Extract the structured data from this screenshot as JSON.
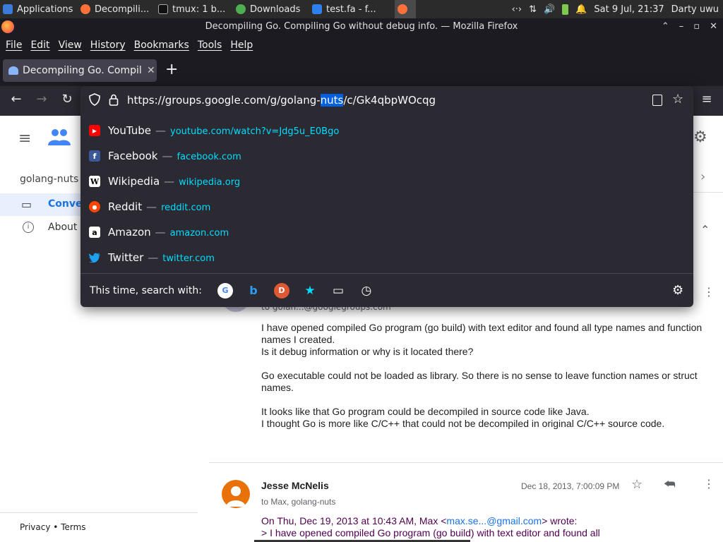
{
  "taskbar": {
    "items": [
      "Applications",
      "Decompili...",
      "tmux: 1 b...",
      "Downloads",
      "test.fa - f...",
      ""
    ],
    "clock": "Sat  9 Jul, 21:37",
    "user": "Darty uwu"
  },
  "window": {
    "title": "Decompiling Go. Compiling Go without debug info. — Mozilla Firefox"
  },
  "menu": [
    "File",
    "Edit",
    "View",
    "History",
    "Bookmarks",
    "Tools",
    "Help"
  ],
  "tab": {
    "label": "Decompiling Go. Compiling",
    "new_tab": "+"
  },
  "url": {
    "before": "https://groups.google.com/g/golang-",
    "highlight": "nuts",
    "after": "/c/Gk4qbpWOcqg"
  },
  "suggestions": [
    {
      "title": "YouTube",
      "url": "youtube.com/watch?v=Jdg5u_E0Bgo",
      "fav_color": "#ff0000",
      "fav_glyph": "▶"
    },
    {
      "title": "Facebook",
      "url": "facebook.com",
      "fav_color": "#3b5998",
      "fav_glyph": "f"
    },
    {
      "title": "Wikipedia",
      "url": "wikipedia.org",
      "fav_color": "#ffffff",
      "fav_glyph": "W"
    },
    {
      "title": "Reddit",
      "url": "reddit.com",
      "fav_color": "#ff4500",
      "fav_glyph": "●"
    },
    {
      "title": "Amazon",
      "url": "amazon.com",
      "fav_color": "#ffffff",
      "fav_glyph": "a"
    },
    {
      "title": "Twitter",
      "url": "twitter.com",
      "fav_color": "#1da1f2",
      "fav_glyph": "🐦"
    }
  ],
  "search_with": {
    "label": "This time, search with:",
    "engines": [
      "G",
      "b",
      "D",
      "★",
      "▭",
      "◷"
    ]
  },
  "group": {
    "name": "golang-nuts",
    "nav_conversations": "Conver",
    "nav_about": "About",
    "footer_privacy": "Privacy",
    "footer_dot": "•",
    "footer_terms": "Terms"
  },
  "post1": {
    "to": "to golan...@googlegroups.com",
    "paragraphs": [
      "I have opened compiled Go program (go build) with text editor and found all type names and function names I created.",
      "Is it debug information or why is it located there?",
      "Go executable could not be loaded as library. So there is no sense to leave function names or struct names.",
      "It looks like that Go program could be decompiled in source code like Java.",
      "I thought Go is more like C/C++ that could not be decompiled in original C/C++ source code."
    ]
  },
  "post2": {
    "author": "Jesse McNelis",
    "date": "Dec 18, 2013, 7:00:09 PM",
    "to": "to Max, golang-nuts",
    "quote_head_pre": "On Thu, Dec 19, 2013 at 10:43 AM, Max <",
    "quote_email": "max.se...@gmail.com",
    "quote_head_post": "> wrote:",
    "quote_line": "> I have opened compiled Go program (go build) with text editor and found all"
  },
  "colors": {
    "accent_blue": "#1a73e8",
    "link_cyan": "#00ddff",
    "firefox_dark": "#2b2a33"
  }
}
